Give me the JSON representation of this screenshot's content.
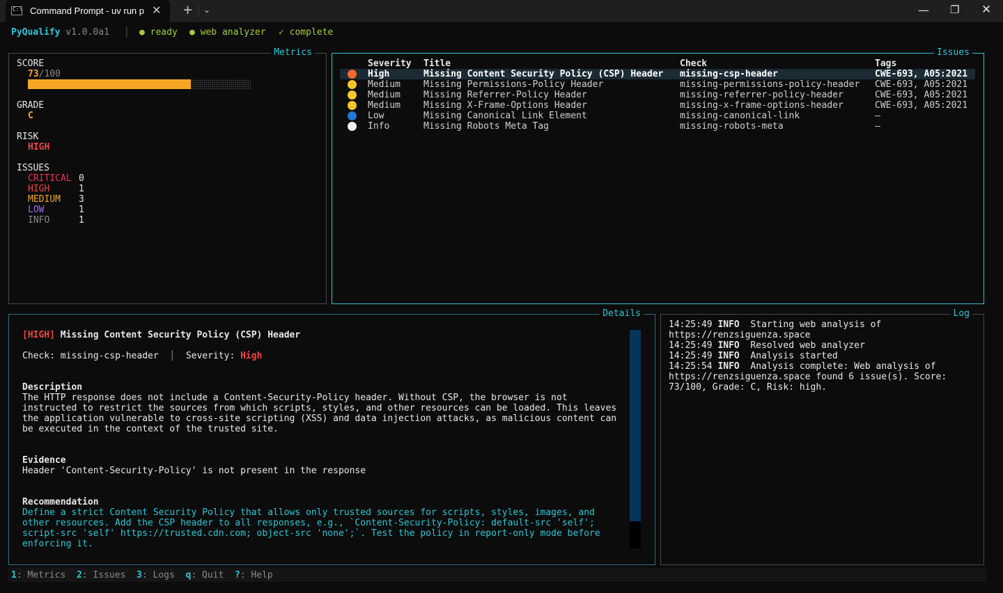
{
  "window": {
    "tab_icon_text": "C:\\",
    "tab_title": "Command Prompt - uv  run p",
    "tab_close": "✕",
    "new_tab": "+",
    "dropdown": "⌄",
    "minimize": "—",
    "maximize": "❐",
    "close": "✕"
  },
  "header": {
    "app_name": "PyQualify",
    "version": "v1.0.0a1",
    "sep": "│",
    "status_ready_icon": "●",
    "status_ready": "ready",
    "status_analyzer_icon": "●",
    "status_analyzer": "web analyzer",
    "status_complete_icon": "✓",
    "status_complete": "complete"
  },
  "metrics": {
    "title": "Metrics",
    "score_label": "SCORE",
    "score_value": "73",
    "score_max": "/100",
    "score_fraction": 0.73,
    "grade_label": "GRADE",
    "grade_value": "C",
    "risk_label": "RISK",
    "risk_value": "HIGH",
    "issues_label": "ISSUES",
    "counts": [
      {
        "label": "CRITICAL",
        "value": "0",
        "color": "#e6325a"
      },
      {
        "label": "HIGH",
        "value": "1",
        "color": "#ee4444"
      },
      {
        "label": "MEDIUM",
        "value": "3",
        "color": "#f5a623"
      },
      {
        "label": "LOW",
        "value": "1",
        "color": "#9a6bf0"
      },
      {
        "label": "INFO",
        "value": "1",
        "color": "#8a8a8a"
      }
    ]
  },
  "issues": {
    "title": "Issues",
    "columns": {
      "severity": "Severity",
      "title": "Title",
      "check": "Check",
      "tags": "Tags"
    },
    "rows": [
      {
        "dot_color": "#f26b2a",
        "severity": "High",
        "title": "Missing Content Security Policy (CSP) Header",
        "check": "missing-csp-header",
        "tags": "CWE-693, A05:2021"
      },
      {
        "dot_color": "#f7c52b",
        "severity": "Medium",
        "title": "Missing Permissions-Policy Header",
        "check": "missing-permissions-policy-header",
        "tags": "CWE-693, A05:2021"
      },
      {
        "dot_color": "#f7c52b",
        "severity": "Medium",
        "title": "Missing Referrer-Policy Header",
        "check": "missing-referrer-policy-header",
        "tags": "CWE-693, A05:2021"
      },
      {
        "dot_color": "#f7c52b",
        "severity": "Medium",
        "title": "Missing X-Frame-Options Header",
        "check": "missing-x-frame-options-header",
        "tags": "CWE-693, A05:2021"
      },
      {
        "dot_color": "#1f7ad1",
        "severity": "Low",
        "title": "Missing Canonical Link Element",
        "check": "missing-canonical-link",
        "tags": "–"
      },
      {
        "dot_color": "#f2f2f2",
        "severity": "Info",
        "title": "Missing Robots Meta Tag",
        "check": "missing-robots-meta",
        "tags": "–"
      }
    ]
  },
  "details": {
    "title": "Details",
    "severity_tag": "[HIGH]",
    "issue_title": "Missing Content Security Policy (CSP) Header",
    "check_label": "Check:",
    "check_value": "missing-csp-header",
    "sep": "│",
    "severity_label": "Severity:",
    "severity_value": "High",
    "description_heading": "Description",
    "description_lines": [
      "The HTTP response does not include a Content-Security-Policy header. Without CSP, the browser is not",
      "instructed to restrict the sources from which scripts, styles, and other resources can be loaded. This leaves",
      "the application vulnerable to cross-site scripting (XSS) and data injection attacks, as malicious content can",
      "be executed in the context of the trusted site."
    ],
    "evidence_heading": "Evidence",
    "evidence": "Header 'Content-Security-Policy' is not present in the response",
    "recommendation_heading": "Recommendation",
    "recommendation_lines": [
      "Define a strict Content Security Policy that allows only trusted sources for scripts, styles, images, and",
      "other resources. Add the CSP header to all responses, e.g., `Content-Security-Policy: default-src 'self';",
      "script-src 'self' https://trusted.cdn.com; object-src 'none';`. Test the policy in report-only mode before",
      "enforcing it."
    ]
  },
  "log": {
    "title": "Log",
    "lines": [
      {
        "time": "14:25:49",
        "level": "INFO",
        "msg": " Starting web analysis of"
      },
      {
        "time": "",
        "level": "",
        "msg": "https://renzsiguenza.space"
      },
      {
        "time": "14:25:49",
        "level": "INFO",
        "msg": " Resolved web analyzer"
      },
      {
        "time": "14:25:49",
        "level": "INFO",
        "msg": " Analysis started"
      },
      {
        "time": "14:25:54",
        "level": "INFO",
        "msg": " Analysis complete: Web analysis of"
      },
      {
        "time": "",
        "level": "",
        "msg": "https://renzsiguenza.space found 6 issue(s). Score:"
      },
      {
        "time": "",
        "level": "",
        "msg": "73/100, Grade: C, Risk: high."
      }
    ]
  },
  "footer": {
    "keys": [
      {
        "key": "1",
        "label": "Metrics"
      },
      {
        "key": "2",
        "label": "Issues"
      },
      {
        "key": "3",
        "label": "Logs"
      },
      {
        "key": "q",
        "label": "Quit"
      },
      {
        "key": "?",
        "label": "Help"
      }
    ]
  }
}
